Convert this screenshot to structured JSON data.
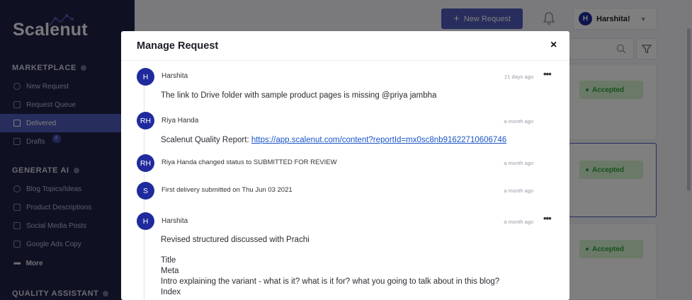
{
  "sidebar": {
    "logo": "Scalenut",
    "sections": [
      {
        "title": "MARKETPLACE",
        "items": [
          "New Request",
          "Request Queue",
          "Delivered",
          "Drafts"
        ]
      },
      {
        "title": "GENERATE AI",
        "items": [
          "Blog Topics/Ideas",
          "Product Descriptions",
          "Social Media Posts",
          "Google Ads Copy",
          "More"
        ]
      },
      {
        "title": "QUALITY ASSISTANT"
      }
    ],
    "drafts_badge": "!!"
  },
  "header": {
    "new_request_label": "New Request",
    "user_initial": "H",
    "user_name": "Harshita!"
  },
  "cards": {
    "status_labels": [
      "Accepted",
      "Accepted",
      "Accepted"
    ]
  },
  "modal": {
    "title": "Manage Request",
    "close_label": "×",
    "entries": [
      {
        "initials": "H",
        "name": "Harshita",
        "time": "21 days ago",
        "message": "The link to Drive folder with sample product pages is missing @priya jambha"
      },
      {
        "initials": "RH",
        "name": "Riya Handa",
        "time": "a month ago",
        "message_prefix": "Scalenut Quality Report: ",
        "link": "https://app.scalenut.com/content?reportId=mx0sc8nb91622710606746"
      },
      {
        "initials": "RH",
        "name": "Riya Handa changed status to SUBMITTED FOR REVIEW",
        "time": "a month ago"
      },
      {
        "initials": "S",
        "name": "First delivery submitted on Thu Jun 03 2021",
        "time": "a month ago"
      },
      {
        "initials": "H",
        "name": "Harshita",
        "time": "a month ago",
        "lines": [
          "Revised structured discussed with Prachi",
          "Title",
          "Meta",
          "Intro explaining the variant - what is it? what is it for? what you going to talk about in this blog?",
          "Index"
        ]
      }
    ]
  }
}
